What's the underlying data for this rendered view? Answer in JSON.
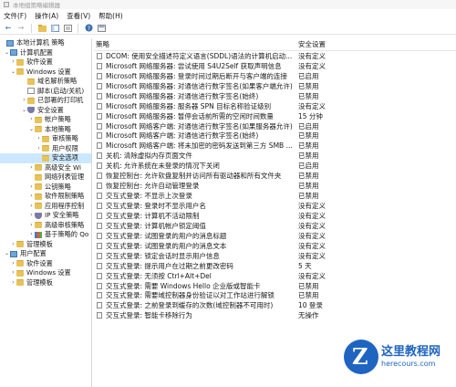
{
  "window": {
    "title": "本地组策略编辑器"
  },
  "menu": [
    "文件(F)",
    "操作(A)",
    "查看(V)",
    "帮助(H)"
  ],
  "toolbar": {
    "icons": [
      "back-arrow-icon",
      "forward-arrow-icon",
      "folder-up-icon",
      "show-hide-tree-icon",
      "export-list-icon",
      "help-icon",
      "properties-icon"
    ]
  },
  "tree": [
    {
      "label": "本地计算机 策略",
      "expander": "",
      "icon": "pc",
      "selected": false
    },
    {
      "label": "计算机配置",
      "expander": "⌄",
      "icon": "pc",
      "selected": false
    },
    {
      "label": "软件设置",
      "expander": "›",
      "icon": "folder",
      "selected": false
    },
    {
      "label": "Windows 设置",
      "expander": "⌄",
      "icon": "folder",
      "selected": false
    },
    {
      "label": "域名解析策略",
      "expander": "",
      "icon": "folder",
      "selected": false
    },
    {
      "label": "脚本(启动/关机)",
      "expander": "",
      "icon": "doc",
      "selected": false
    },
    {
      "label": "已部署的打印机",
      "expander": "›",
      "icon": "folder",
      "selected": false
    },
    {
      "label": "安全设置",
      "expander": "⌄",
      "icon": "shield",
      "selected": false
    },
    {
      "label": "帐户策略",
      "expander": "›",
      "icon": "folder",
      "selected": false
    },
    {
      "label": "本地策略",
      "expander": "⌄",
      "icon": "folder",
      "selected": false
    },
    {
      "label": "审核策略",
      "expander": "›",
      "icon": "folder",
      "selected": false
    },
    {
      "label": "用户权限",
      "expander": "›",
      "icon": "folder",
      "selected": false
    },
    {
      "label": "安全选项",
      "expander": "",
      "icon": "folder",
      "selected": true
    },
    {
      "label": "高级安全 Wi",
      "expander": "›",
      "icon": "folder",
      "selected": false
    },
    {
      "label": "网络列表管理",
      "expander": "",
      "icon": "folder",
      "selected": false
    },
    {
      "label": "公钥策略",
      "expander": "›",
      "icon": "folder",
      "selected": false
    },
    {
      "label": "软件限制策略",
      "expander": "›",
      "icon": "folder",
      "selected": false
    },
    {
      "label": "应用程序控制",
      "expander": "›",
      "icon": "folder",
      "selected": false
    },
    {
      "label": "IP 安全策略",
      "expander": "›",
      "icon": "shield",
      "selected": false
    },
    {
      "label": "高级审核策略",
      "expander": "›",
      "icon": "folder",
      "selected": false
    },
    {
      "label": "基于策略的 Qo",
      "expander": "›",
      "icon": "chart",
      "selected": false
    },
    {
      "label": "管理模板",
      "expander": "›",
      "icon": "folder",
      "selected": false
    },
    {
      "label": "用户配置",
      "expander": "⌄",
      "icon": "pc",
      "selected": false
    },
    {
      "label": "软件设置",
      "expander": "›",
      "icon": "folder",
      "selected": false
    },
    {
      "label": "Windows 设置",
      "expander": "›",
      "icon": "folder",
      "selected": false
    },
    {
      "label": "管理模板",
      "expander": "›",
      "icon": "folder",
      "selected": false
    }
  ],
  "table": {
    "columns": [
      "策略",
      "安全设置"
    ],
    "rows": [
      [
        "DCOM: 使用安全描述符定义语言(SDDL)语法的计算机启动...",
        "没有定义"
      ],
      [
        "Microsoft 网络服务器: 尝试使用 S4U2Self 获取声明信息",
        "没有定义"
      ],
      [
        "Microsoft 网络服务器: 登录时间过期后断开与客户端的连接",
        "已启用"
      ],
      [
        "Microsoft 网络服务器: 对通信进行数字签名(如果客户端允许)",
        "已禁用"
      ],
      [
        "Microsoft 网络服务器: 对通信进行数字签名(始终)",
        "已禁用"
      ],
      [
        "Microsoft 网络服务器: 服务器 SPN 目标名称验证级别",
        "没有定义"
      ],
      [
        "Microsoft 网络服务器: 暂停会话前所需的空闲时间数量",
        "15 分钟"
      ],
      [
        "Microsoft 网络客户端: 对通信进行数字签名(如果服务器允许)",
        "已启用"
      ],
      [
        "Microsoft 网络客户端: 对通信进行数字签名(始终)",
        "已禁用"
      ],
      [
        "Microsoft 网络客户端: 将未加密的密码发送到第三方 SMB ...",
        "已禁用"
      ],
      [
        "关机: 清除虚拟内存页面文件",
        "已禁用"
      ],
      [
        "关机: 允许系统在未登录的情况下关闭",
        "已启用"
      ],
      [
        "恢复控制台: 允许软盘复制并访问所有驱动器和所有文件夹",
        "已禁用"
      ],
      [
        "恢复控制台: 允许自动管理登录",
        "已禁用"
      ],
      [
        "交互式登录: 不显示上次登录",
        "已禁用"
      ],
      [
        "交互式登录: 登录时不显示用户名",
        "没有定义"
      ],
      [
        "交互式登录: 计算机不活动限制",
        "没有定义"
      ],
      [
        "交互式登录: 计算机帐户锁定阈值",
        "没有定义"
      ],
      [
        "交互式登录: 试图登录的用户的消息标题",
        "没有定义"
      ],
      [
        "交互式登录: 试图登录的用户的消息文本",
        "没有定义"
      ],
      [
        "交互式登录: 锁定会话时显示用户信息",
        "没有定义"
      ],
      [
        "交互式登录: 提示用户在过期之前更改密码",
        "5 天"
      ],
      [
        "交互式登录: 无须按 Ctrl+Alt+Del",
        "没有定义"
      ],
      [
        "交互式登录: 需要 Windows Hello 企业版或智能卡",
        "已禁用"
      ],
      [
        "交互式登录: 需要域控制器身份验证以对工作站进行解锁",
        "已禁用"
      ],
      [
        "交互式登录: 之前登录到缓存的次数(域控制器不可用时)",
        "10 登录"
      ],
      [
        "交互式登录: 智能卡移除行为",
        "无操作"
      ]
    ]
  },
  "watermark": {
    "title": "这里教程网",
    "url": "herecours.com"
  }
}
